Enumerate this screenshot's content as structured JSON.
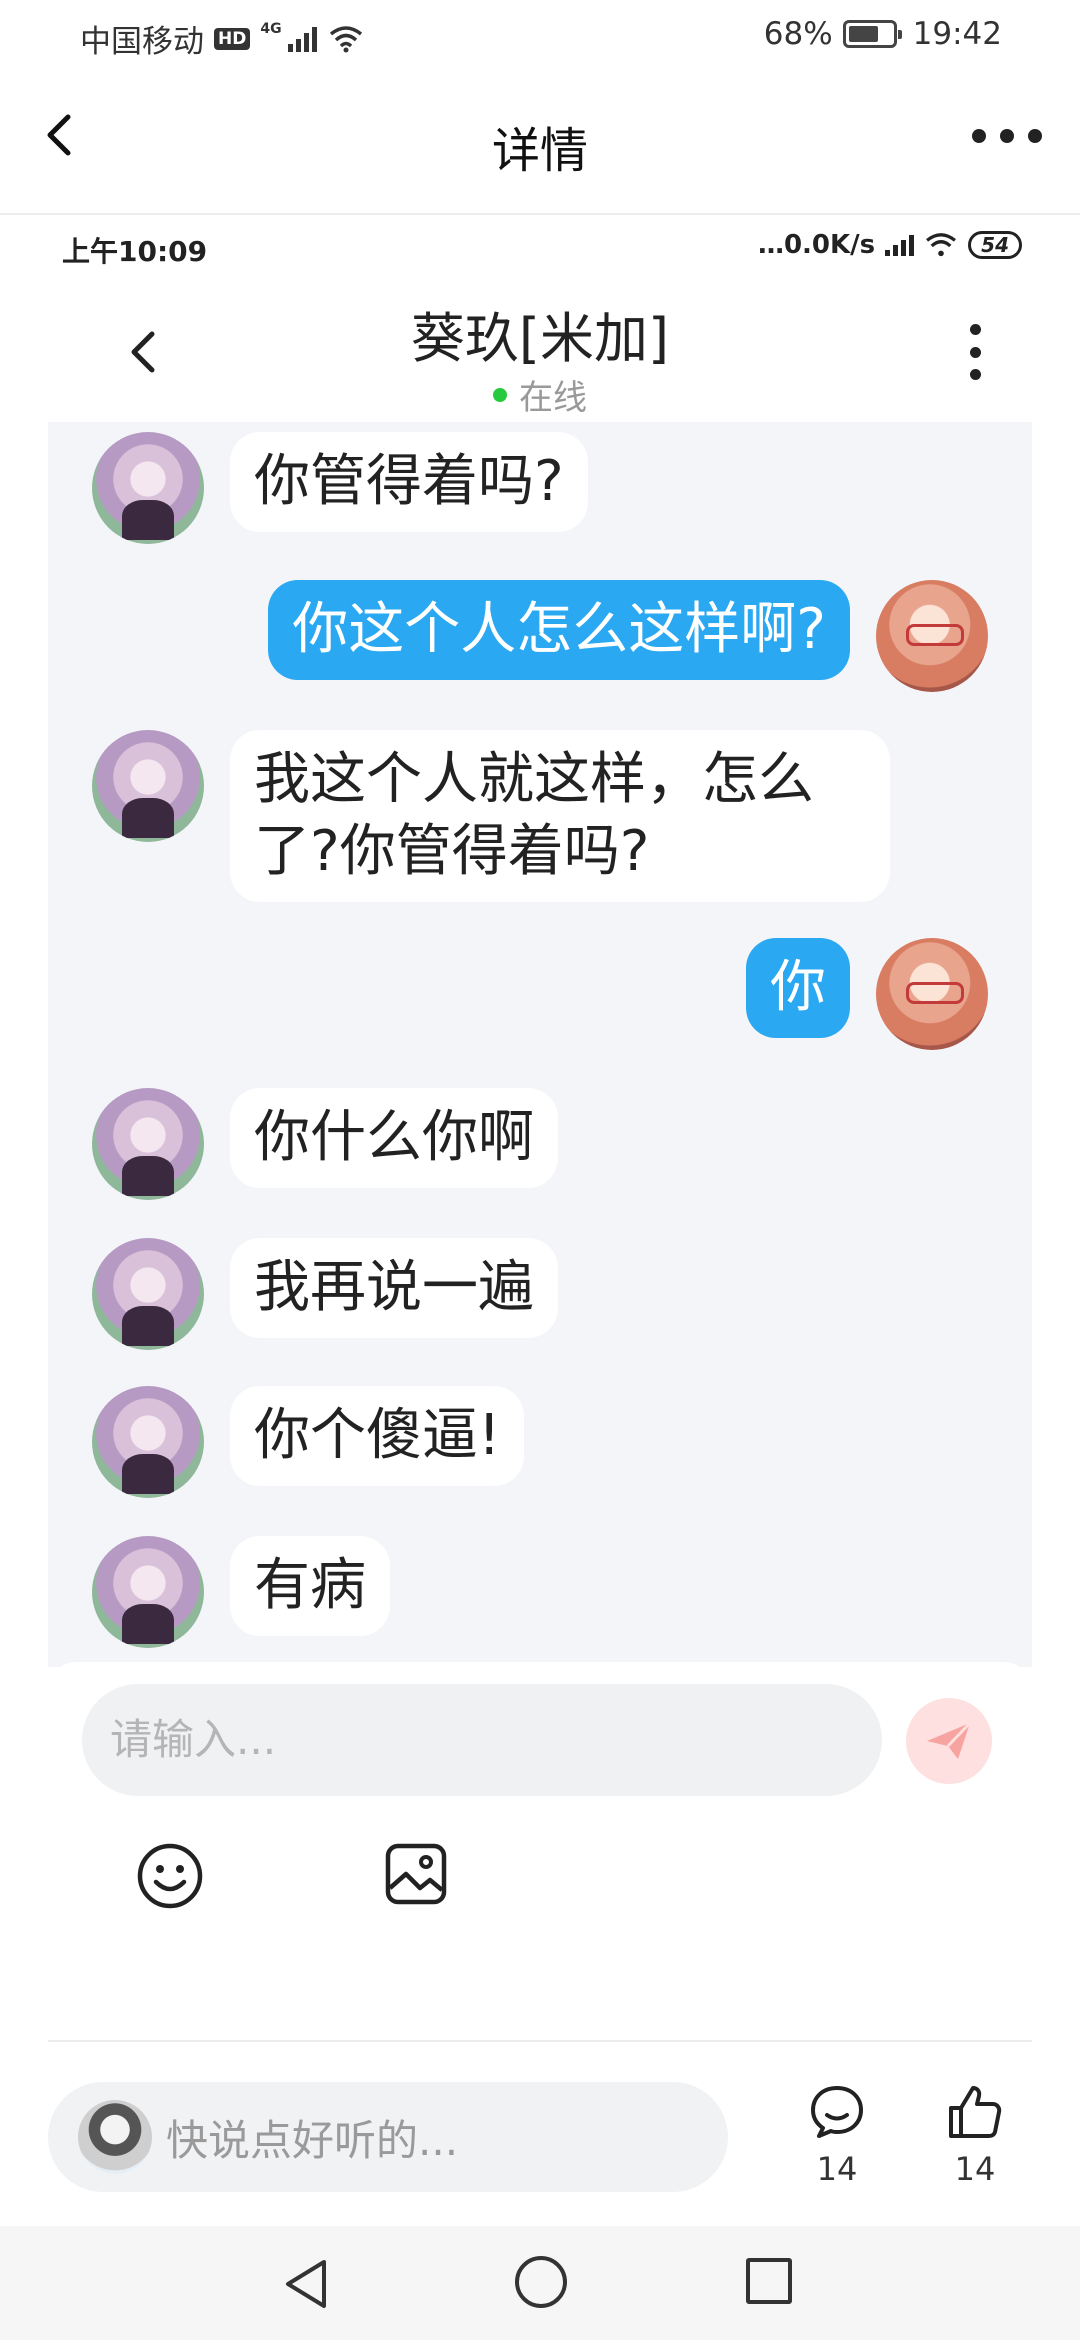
{
  "status_bar": {
    "carrier": "中国移动",
    "hd": "HD",
    "network": "4G",
    "battery_text": "68%",
    "battery_level": 0.68,
    "time": "19:42"
  },
  "outer_nav": {
    "title": "详情"
  },
  "inner_status": {
    "time": "上午10:09",
    "speed": "…0.0K/s",
    "battery": "54"
  },
  "inner_header": {
    "title": "葵玖[米加]",
    "status": "在线"
  },
  "messages": [
    {
      "side": "in",
      "text": "你管得着吗?"
    },
    {
      "side": "out",
      "text": "你这个人怎么这样啊?"
    },
    {
      "side": "in",
      "text": "我这个人就这样，怎么了?你管得着吗?"
    },
    {
      "side": "out",
      "text": "你"
    },
    {
      "side": "in",
      "text": "你什么你啊"
    },
    {
      "side": "in",
      "text": "我再说一遍"
    },
    {
      "side": "in",
      "text": "你个傻逼!"
    },
    {
      "side": "in",
      "text": "有病"
    }
  ],
  "input": {
    "placeholder": "请输入..."
  },
  "bottom_bar": {
    "comment_placeholder": "快说点好听的...",
    "comment_count": "14",
    "like_count": "14"
  },
  "colors": {
    "accent_blue": "#2aa8f2",
    "chat_bg": "#f4f5f8",
    "online_green": "#27c93f",
    "send_disabled": "#fde0df"
  }
}
